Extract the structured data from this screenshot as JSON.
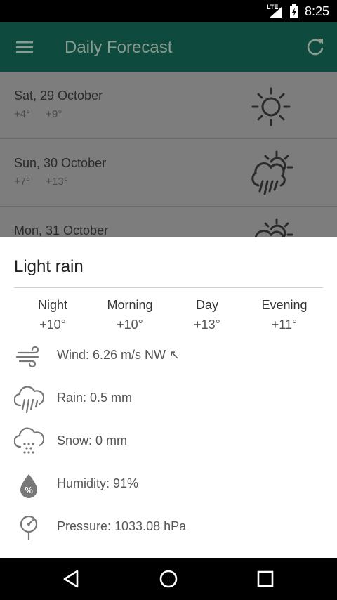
{
  "status_bar": {
    "network": "LTE",
    "time": "8:25"
  },
  "app_bar": {
    "title": "Daily Forecast"
  },
  "forecast_list": [
    {
      "date": "Sat, 29 October",
      "low": "+4°",
      "high": "+9°",
      "icon": "sun-icon"
    },
    {
      "date": "Sun, 30 October",
      "low": "+7°",
      "high": "+13°",
      "icon": "rain-sun-icon"
    },
    {
      "date": "Mon, 31 October",
      "low": "",
      "high": "",
      "icon": "partly-cloudy-icon"
    }
  ],
  "sheet": {
    "title": "Light rain",
    "periods": [
      {
        "label": "Night",
        "temp": "+10°"
      },
      {
        "label": "Morning",
        "temp": "+10°"
      },
      {
        "label": "Day",
        "temp": "+13°"
      },
      {
        "label": "Evening",
        "temp": "+11°"
      }
    ],
    "details": [
      {
        "icon": "wind-icon",
        "text": "Wind: 6.26 m/s NW ↖"
      },
      {
        "icon": "rain-icon",
        "text": "Rain: 0.5 mm"
      },
      {
        "icon": "snow-icon",
        "text": "Snow: 0 mm"
      },
      {
        "icon": "humidity-icon",
        "text": "Humidity: 91%"
      },
      {
        "icon": "pressure-icon",
        "text": "Pressure: 1033.08 hPa"
      }
    ]
  },
  "colors": {
    "app_bar": "#0e4a3e",
    "scrim": "#7d7d7d",
    "sheet": "#ffffff"
  }
}
